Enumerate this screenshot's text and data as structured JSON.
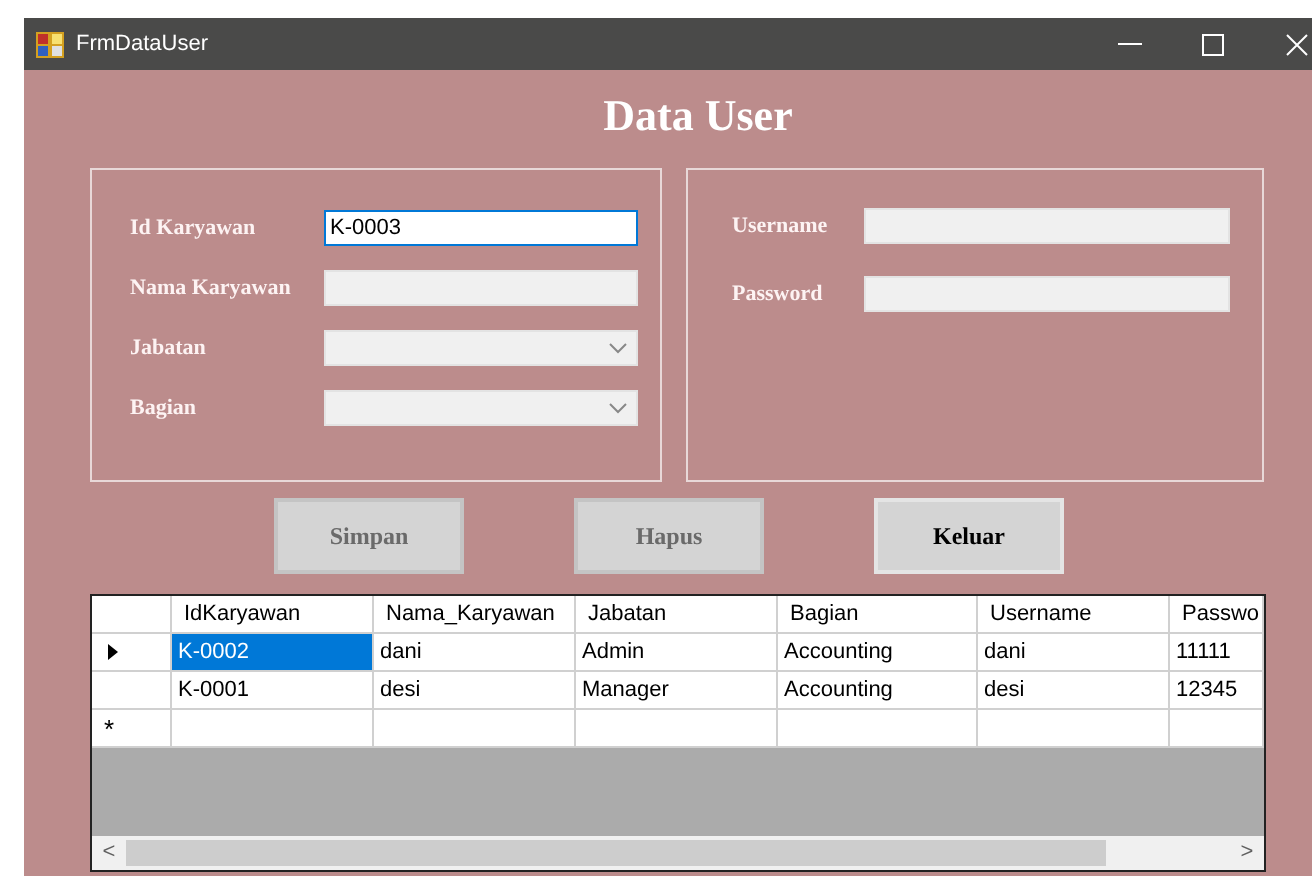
{
  "window": {
    "title": "FrmDataUser"
  },
  "heading": "Data User",
  "employee_fields": [
    {
      "label": "Id Karyawan",
      "kind": "text",
      "value": "K-0003",
      "focused": true,
      "disabled": false
    },
    {
      "label": "Nama Karyawan",
      "kind": "text",
      "focused": false,
      "disabled": true
    },
    {
      "label": "Jabatan",
      "kind": "combo",
      "focused": false,
      "disabled": true
    },
    {
      "label": "Bagian",
      "kind": "combo",
      "focused": false,
      "disabled": true
    }
  ],
  "account_fields": [
    {
      "label": "Username",
      "focused": false,
      "disabled": true
    },
    {
      "label": "Password",
      "focused": false,
      "disabled": true
    }
  ],
  "buttons": [
    {
      "label": "Simpan",
      "disabled": true
    },
    {
      "label": "Hapus",
      "disabled": true
    },
    {
      "label": "Keluar",
      "disabled": false
    }
  ],
  "table": {
    "columns": [
      "IdKaryawan",
      "Nama_Karyawan",
      "Jabatan",
      "Bagian",
      "Username",
      "Passwo"
    ],
    "rows": [
      {
        "current": true,
        "cells": [
          {
            "text": "K-0002",
            "selected": true
          },
          {
            "text": "dani",
            "selected": false
          },
          {
            "text": "Admin",
            "selected": false
          },
          {
            "text": "Accounting",
            "selected": false
          },
          {
            "text": "dani",
            "selected": false
          },
          {
            "text": "11111",
            "selected": false
          }
        ]
      },
      {
        "current": false,
        "cells": [
          {
            "text": "K-0001",
            "selected": false
          },
          {
            "text": "desi",
            "selected": false
          },
          {
            "text": "Manager",
            "selected": false
          },
          {
            "text": "Accounting",
            "selected": false
          },
          {
            "text": "desi",
            "selected": false
          },
          {
            "text": "12345",
            "selected": false
          }
        ]
      }
    ],
    "new_row_marker": "*",
    "scroll_left": "<",
    "scroll_right": ">"
  }
}
